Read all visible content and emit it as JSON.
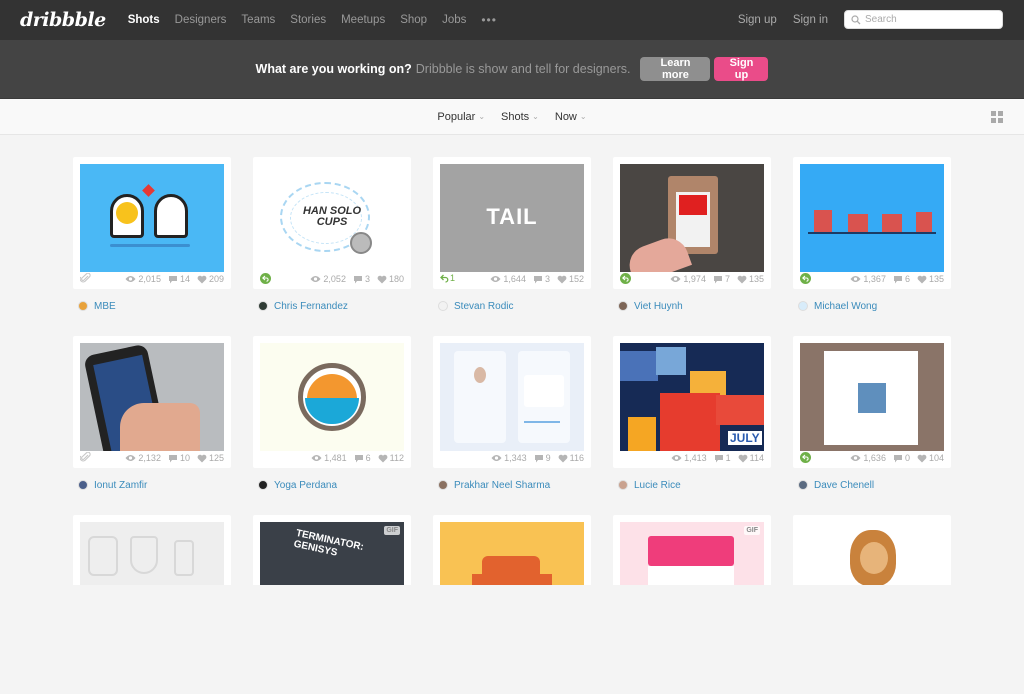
{
  "header": {
    "logo": "dribbble",
    "nav": [
      {
        "label": "Shots",
        "active": true
      },
      {
        "label": "Designers"
      },
      {
        "label": "Teams"
      },
      {
        "label": "Stories"
      },
      {
        "label": "Meetups"
      },
      {
        "label": "Shop"
      },
      {
        "label": "Jobs"
      }
    ],
    "more": "•••",
    "signup": "Sign up",
    "signin": "Sign in",
    "search_placeholder": "Search"
  },
  "banner": {
    "lead": "What are you working on?",
    "sub": "Dribbble is show and tell for designers.",
    "learn_more": "Learn more",
    "signup": "Sign up"
  },
  "filters": [
    {
      "label": "Popular"
    },
    {
      "label": "Shots"
    },
    {
      "label": "Now"
    }
  ],
  "colors": {
    "brand_pink": "#ea4c89",
    "link_blue": "#3a8bbb",
    "rebound_green": "#6fb048"
  },
  "shots": [
    {
      "author": "MBE",
      "views": "2,015",
      "comments": "14",
      "likes": "209",
      "left": "attachment",
      "thumb": "ghosts"
    },
    {
      "author": "Chris Fernandez",
      "views": "2,052",
      "comments": "3",
      "likes": "180",
      "left": "rebound",
      "thumb": "hansolo",
      "thumb_text": "HAN SOLO CUPS"
    },
    {
      "author": "Stevan Rodic",
      "views": "1,644",
      "comments": "3",
      "likes": "152",
      "left": "rebound-count",
      "rebounds": "1",
      "thumb": "tail",
      "thumb_text": "TAIL"
    },
    {
      "author": "Viet Huynh",
      "views": "1,974",
      "comments": "7",
      "likes": "135",
      "left": "rebound",
      "thumb": "pack"
    },
    {
      "author": "Michael Wong",
      "views": "1,367",
      "comments": "6",
      "likes": "135",
      "left": "rebound",
      "thumb": "houses"
    },
    {
      "author": "Ionut Zamfir",
      "views": "2,132",
      "comments": "10",
      "likes": "125",
      "left": "attachment",
      "thumb": "phone"
    },
    {
      "author": "Yoga Perdana",
      "views": "1,481",
      "comments": "6",
      "likes": "112",
      "left": "none",
      "thumb": "logo"
    },
    {
      "author": "Prakhar Neel Sharma",
      "views": "1,343",
      "comments": "9",
      "likes": "116",
      "left": "none",
      "thumb": "appui"
    },
    {
      "author": "Lucie Rice",
      "views": "1,413",
      "comments": "1",
      "likes": "114",
      "left": "none",
      "thumb": "city",
      "thumb_text": "JULY"
    },
    {
      "author": "Dave Chenell",
      "views": "1,636",
      "comments": "0",
      "likes": "104",
      "left": "rebound",
      "thumb": "frame"
    }
  ],
  "partial_shots": [
    {
      "thumb": "icons"
    },
    {
      "thumb": "terminator",
      "thumb_text": "TERMINATOR: GENISYS",
      "badge": "GIF"
    },
    {
      "thumb": "car"
    },
    {
      "thumb": "pinkapp",
      "badge": "GIF"
    },
    {
      "thumb": "lion"
    }
  ]
}
